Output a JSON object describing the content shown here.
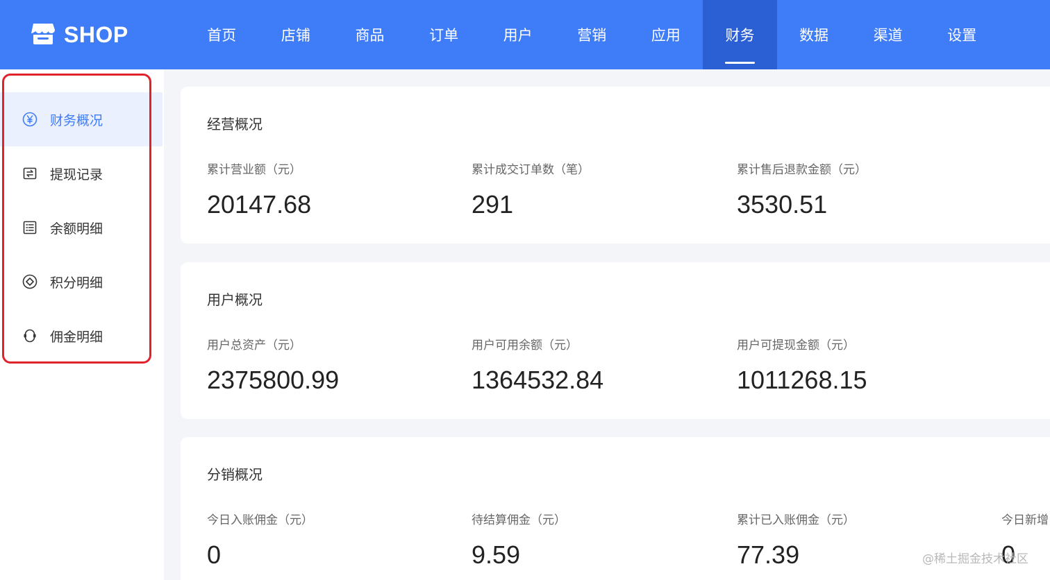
{
  "brand": {
    "name": "SHOP",
    "icon": "store-icon",
    "color": "#3f7cf7"
  },
  "nav": {
    "items": [
      {
        "label": "首页"
      },
      {
        "label": "店铺"
      },
      {
        "label": "商品"
      },
      {
        "label": "订单"
      },
      {
        "label": "用户"
      },
      {
        "label": "营销"
      },
      {
        "label": "应用"
      },
      {
        "label": "财务",
        "active": true
      },
      {
        "label": "数据"
      },
      {
        "label": "渠道"
      },
      {
        "label": "设置"
      }
    ]
  },
  "sidebar": {
    "items": [
      {
        "label": "财务概况",
        "icon": "yen-circle-icon",
        "active": true
      },
      {
        "label": "提现记录",
        "icon": "withdraw-icon"
      },
      {
        "label": "余额明细",
        "icon": "list-icon"
      },
      {
        "label": "积分明细",
        "icon": "diamond-circle-icon"
      },
      {
        "label": "佣金明细",
        "icon": "commission-icon"
      }
    ],
    "highlight_color": "#e0222c"
  },
  "cards": {
    "business": {
      "title": "经营概况",
      "stats": [
        {
          "label": "累计营业额（元）",
          "value": "20147.68"
        },
        {
          "label": "累计成交订单数（笔）",
          "value": "291"
        },
        {
          "label": "累计售后退款金额（元）",
          "value": "3530.51"
        }
      ]
    },
    "users": {
      "title": "用户概况",
      "stats": [
        {
          "label": "用户总资产（元）",
          "value": "2375800.99"
        },
        {
          "label": "用户可用余额（元）",
          "value": "1364532.84"
        },
        {
          "label": "用户可提现金额（元）",
          "value": "1011268.15"
        }
      ]
    },
    "distribution": {
      "title": "分销概况",
      "stats": [
        {
          "label": "今日入账佣金（元）",
          "value": "0"
        },
        {
          "label": "待结算佣金（元）",
          "value": "9.59"
        },
        {
          "label": "累计已入账佣金（元）",
          "value": "77.39"
        },
        {
          "label": "今日新增",
          "value": "0"
        }
      ]
    }
  },
  "watermark": "@稀土掘金技术社区"
}
